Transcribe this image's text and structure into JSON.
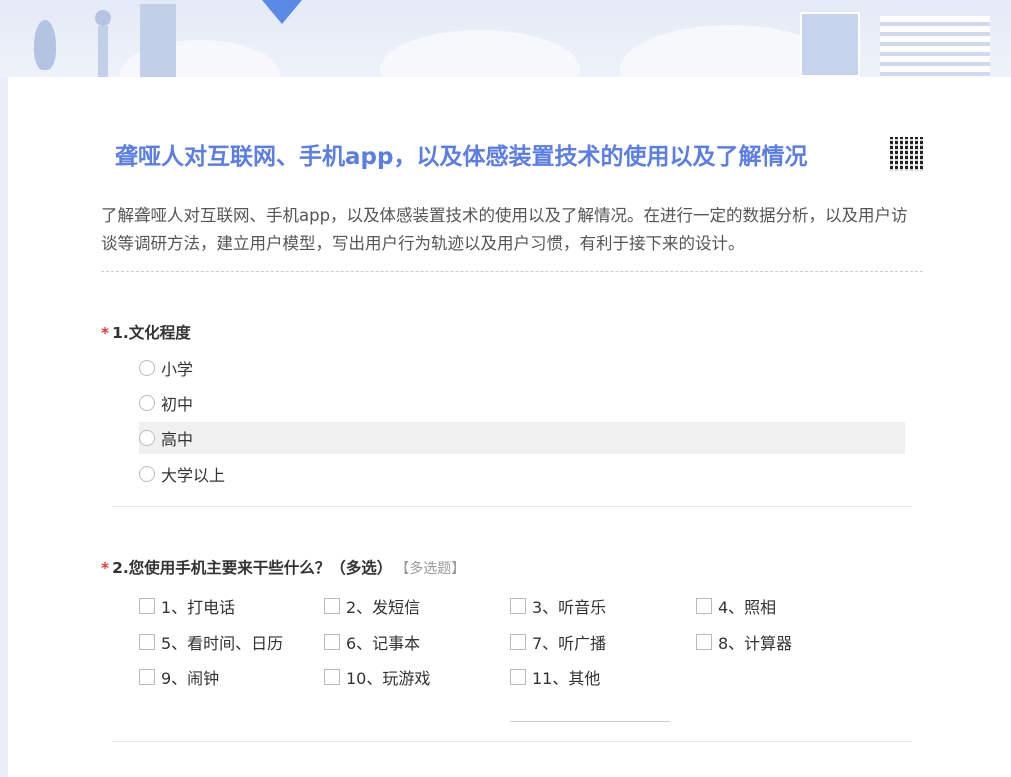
{
  "survey": {
    "title": "聋哑人对互联网、手机app，以及体感装置技术的使用以及了解情况",
    "description": "了解聋哑人对互联网、手机app，以及体感装置技术的使用以及了解情况。在进行一定的数据分析，以及用户访谈等调研方法，建立用户模型，写出用户行为轨迹以及用户习惯，有利于接下来的设计。"
  },
  "questions": [
    {
      "required": "*",
      "title": "1.文化程度",
      "options": [
        "小学",
        "初中",
        "高中",
        "大学以上"
      ]
    },
    {
      "required": "*",
      "title": "2.您使用手机主要来干些什么？（多选）",
      "tag": "【多选题】",
      "options": [
        "1、打电话",
        "2、发短信",
        "3、听音乐",
        "4、照相",
        "5、看时间、日历",
        "6、记事本",
        "7、听广播",
        "8、计算器",
        "9、闹钟",
        "10、玩游戏",
        "11、其他"
      ]
    }
  ],
  "colors": {
    "title": "#5b7ee6",
    "required": "#e33333"
  }
}
